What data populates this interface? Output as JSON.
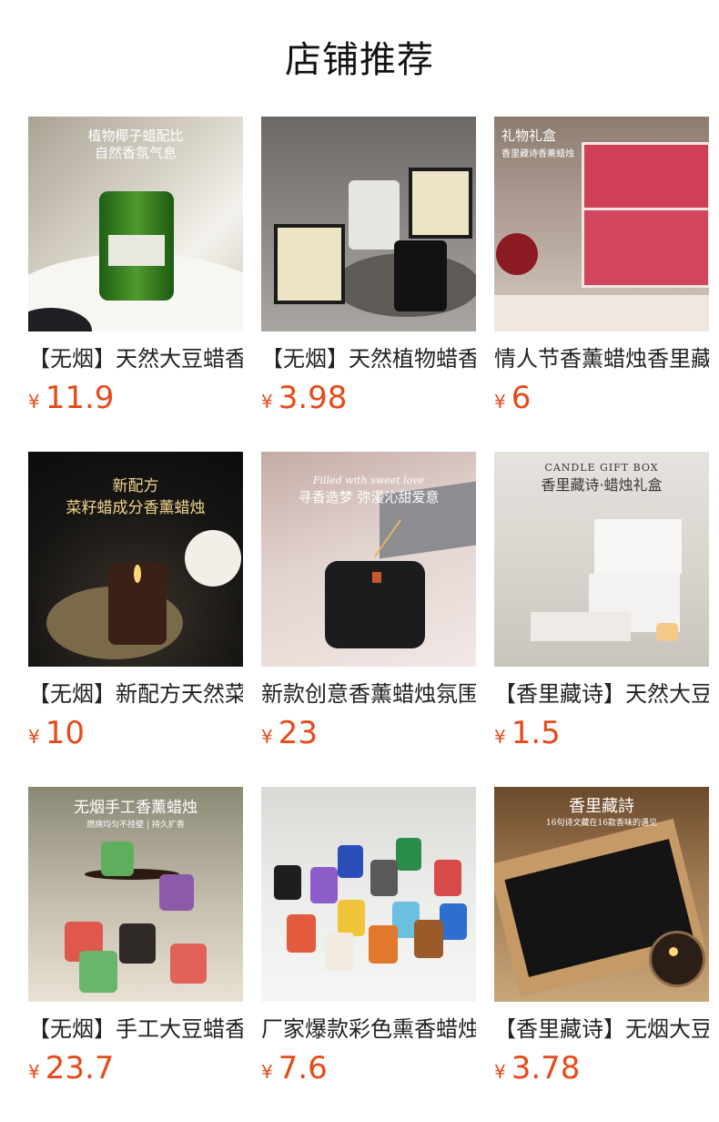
{
  "header": {
    "title": "店铺推荐"
  },
  "currency": "¥",
  "products": [
    {
      "title": "【无烟】天然大豆蜡香薰蜡烛",
      "price": "11.9",
      "overlay": [
        "植物椰子蜡配比",
        "自然香氛气息"
      ]
    },
    {
      "title": "【无烟】天然植物蜡香薰蜡烛",
      "price": "3.98",
      "overlay": []
    },
    {
      "title": "情人节香薰蜡烛香里藏诗礼盒",
      "price": "6",
      "overlay": [
        "礼物礼盒",
        "香里藏诗香薰蜡烛"
      ]
    },
    {
      "title": "【无烟】新配方天然菜籽蜡",
      "price": "10",
      "overlay": [
        "新配方",
        "菜籽蜡成分香薰蜡烛"
      ]
    },
    {
      "title": "新款创意香薰蜡烛氛围感",
      "price": "23",
      "overlay": [
        "Filled with sweet love",
        "寻香造梦  弥漫沁甜爱意"
      ]
    },
    {
      "title": "【香里藏诗】天然大豆蜡",
      "price": "1.5",
      "overlay": [
        "CANDLE GIFT BOX",
        "香里藏诗·蜡烛礼盒"
      ]
    },
    {
      "title": "【无烟】手工大豆蜡香薰",
      "price": "23.7",
      "overlay": [
        "无烟手工香薰蜡烛",
        "燃烧均匀不挂壁 | 持久扩香"
      ]
    },
    {
      "title": "厂家爆款彩色熏香蜡烛",
      "price": "7.6",
      "overlay": []
    },
    {
      "title": "【香里藏诗】无烟大豆蜡",
      "price": "3.78",
      "overlay": [
        "香里藏詩",
        "16句诗文藏在16款香味的遇见"
      ]
    }
  ],
  "colors": {
    "price": "#e64a19",
    "title": "#111111"
  }
}
